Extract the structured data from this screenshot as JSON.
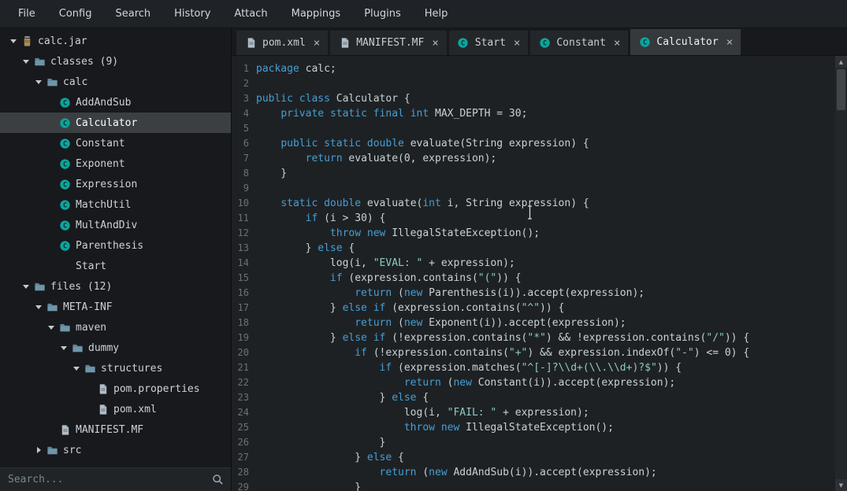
{
  "menu": {
    "items": [
      "File",
      "Config",
      "Search",
      "History",
      "Attach",
      "Mappings",
      "Plugins",
      "Help"
    ]
  },
  "sidebar": {
    "tree": [
      {
        "label": "calc.jar",
        "level": 0,
        "icon": "jar",
        "arrow": "expanded"
      },
      {
        "label": "classes (9)",
        "level": 1,
        "icon": "folder",
        "arrow": "expanded"
      },
      {
        "label": "calc",
        "level": 2,
        "icon": "folder",
        "arrow": "expanded"
      },
      {
        "label": "AddAndSub",
        "level": 3,
        "icon": "class"
      },
      {
        "label": "Calculator",
        "level": 3,
        "icon": "class",
        "selected": true
      },
      {
        "label": "Constant",
        "level": 3,
        "icon": "class"
      },
      {
        "label": "Exponent",
        "level": 3,
        "icon": "class"
      },
      {
        "label": "Expression",
        "level": 3,
        "icon": "class"
      },
      {
        "label": "MatchUtil",
        "level": 3,
        "icon": "class"
      },
      {
        "label": "MultAndDiv",
        "level": 3,
        "icon": "class"
      },
      {
        "label": "Parenthesis",
        "level": 3,
        "icon": "class"
      },
      {
        "label": "Start",
        "level": 3,
        "icon": "none"
      },
      {
        "label": "files (12)",
        "level": 1,
        "icon": "folder",
        "arrow": "expanded"
      },
      {
        "label": "META-INF",
        "level": 2,
        "icon": "folder",
        "arrow": "expanded"
      },
      {
        "label": "maven",
        "level": 3,
        "icon": "folder",
        "arrow": "expanded"
      },
      {
        "label": "dummy",
        "level": 4,
        "icon": "folder",
        "arrow": "expanded"
      },
      {
        "label": "structures",
        "level": 5,
        "icon": "folder",
        "arrow": "expanded"
      },
      {
        "label": "pom.properties",
        "level": 6,
        "icon": "file"
      },
      {
        "label": "pom.xml",
        "level": 6,
        "icon": "file"
      },
      {
        "label": "MANIFEST.MF",
        "level": 3,
        "icon": "file"
      },
      {
        "label": "src",
        "level": 2,
        "icon": "folder",
        "arrow": "collapsed"
      }
    ],
    "search": {
      "placeholder": "Search..."
    }
  },
  "tabs": {
    "close_glyph": "×",
    "items": [
      {
        "label": "pom.xml",
        "icon": "file",
        "active": false
      },
      {
        "label": "MANIFEST.MF",
        "icon": "file",
        "active": false
      },
      {
        "label": "Start",
        "icon": "class",
        "active": false
      },
      {
        "label": "Constant",
        "icon": "class",
        "active": false
      },
      {
        "label": "Calculator",
        "icon": "class",
        "active": true
      }
    ]
  },
  "editor": {
    "lines": [
      {
        "n": 1,
        "segs": [
          [
            "kw",
            "package"
          ],
          [
            "pl",
            " calc;"
          ]
        ]
      },
      {
        "n": 2,
        "segs": []
      },
      {
        "n": 3,
        "segs": [
          [
            "kw",
            "public"
          ],
          [
            "pl",
            " "
          ],
          [
            "kw",
            "class"
          ],
          [
            "pl",
            " Calculator {"
          ]
        ]
      },
      {
        "n": 4,
        "segs": [
          [
            "pl",
            "    "
          ],
          [
            "kw",
            "private"
          ],
          [
            "pl",
            " "
          ],
          [
            "kw",
            "static"
          ],
          [
            "pl",
            " "
          ],
          [
            "kw",
            "final"
          ],
          [
            "pl",
            " "
          ],
          [
            "kw",
            "int"
          ],
          [
            "pl",
            " MAX_DEPTH = 30;"
          ]
        ]
      },
      {
        "n": 5,
        "segs": []
      },
      {
        "n": 6,
        "segs": [
          [
            "pl",
            "    "
          ],
          [
            "kw",
            "public"
          ],
          [
            "pl",
            " "
          ],
          [
            "kw",
            "static"
          ],
          [
            "pl",
            " "
          ],
          [
            "kw",
            "double"
          ],
          [
            "pl",
            " evaluate(String expression) {"
          ]
        ]
      },
      {
        "n": 7,
        "segs": [
          [
            "pl",
            "        "
          ],
          [
            "kw",
            "return"
          ],
          [
            "pl",
            " evaluate(0, expression);"
          ]
        ]
      },
      {
        "n": 8,
        "segs": [
          [
            "pl",
            "    }"
          ]
        ]
      },
      {
        "n": 9,
        "segs": []
      },
      {
        "n": 10,
        "segs": [
          [
            "pl",
            "    "
          ],
          [
            "kw",
            "static"
          ],
          [
            "pl",
            " "
          ],
          [
            "kw",
            "double"
          ],
          [
            "pl",
            " evaluate("
          ],
          [
            "kw",
            "int"
          ],
          [
            "pl",
            " i, String expression) {"
          ]
        ]
      },
      {
        "n": 11,
        "segs": [
          [
            "pl",
            "        "
          ],
          [
            "kw",
            "if"
          ],
          [
            "pl",
            " (i > 30) {"
          ]
        ]
      },
      {
        "n": 12,
        "segs": [
          [
            "pl",
            "            "
          ],
          [
            "kw",
            "throw"
          ],
          [
            "pl",
            " "
          ],
          [
            "kw",
            "new"
          ],
          [
            "pl",
            " IllegalStateException();"
          ]
        ]
      },
      {
        "n": 13,
        "segs": [
          [
            "pl",
            "        } "
          ],
          [
            "kw",
            "else"
          ],
          [
            "pl",
            " {"
          ]
        ]
      },
      {
        "n": 14,
        "segs": [
          [
            "pl",
            "            log(i, "
          ],
          [
            "str",
            "\"EVAL: \""
          ],
          [
            "pl",
            " + expression);"
          ]
        ]
      },
      {
        "n": 15,
        "segs": [
          [
            "pl",
            "            "
          ],
          [
            "kw",
            "if"
          ],
          [
            "pl",
            " (expression.contains("
          ],
          [
            "str",
            "\"(\""
          ],
          [
            "pl",
            ")) {"
          ]
        ]
      },
      {
        "n": 16,
        "segs": [
          [
            "pl",
            "                "
          ],
          [
            "kw",
            "return"
          ],
          [
            "pl",
            " ("
          ],
          [
            "kw",
            "new"
          ],
          [
            "pl",
            " Parenthesis(i)).accept(expression);"
          ]
        ]
      },
      {
        "n": 17,
        "segs": [
          [
            "pl",
            "            } "
          ],
          [
            "kw",
            "else"
          ],
          [
            "pl",
            " "
          ],
          [
            "kw",
            "if"
          ],
          [
            "pl",
            " (expression.contains("
          ],
          [
            "str",
            "\"^\""
          ],
          [
            "pl",
            ")) {"
          ]
        ]
      },
      {
        "n": 18,
        "segs": [
          [
            "pl",
            "                "
          ],
          [
            "kw",
            "return"
          ],
          [
            "pl",
            " ("
          ],
          [
            "kw",
            "new"
          ],
          [
            "pl",
            " Exponent(i)).accept(expression);"
          ]
        ]
      },
      {
        "n": 19,
        "segs": [
          [
            "pl",
            "            } "
          ],
          [
            "kw",
            "else"
          ],
          [
            "pl",
            " "
          ],
          [
            "kw",
            "if"
          ],
          [
            "pl",
            " (!expression.contains("
          ],
          [
            "str",
            "\"*\""
          ],
          [
            "pl",
            ") && !expression.contains("
          ],
          [
            "str",
            "\"/\""
          ],
          [
            "pl",
            ")) {"
          ]
        ]
      },
      {
        "n": 20,
        "segs": [
          [
            "pl",
            "                "
          ],
          [
            "kw",
            "if"
          ],
          [
            "pl",
            " (!expression.contains("
          ],
          [
            "str",
            "\"+\""
          ],
          [
            "pl",
            ") && expression.indexOf("
          ],
          [
            "str",
            "\"-\""
          ],
          [
            "pl",
            ") <= 0) {"
          ]
        ]
      },
      {
        "n": 21,
        "segs": [
          [
            "pl",
            "                    "
          ],
          [
            "kw",
            "if"
          ],
          [
            "pl",
            " (expression.matches("
          ],
          [
            "str",
            "\"^[-]?\\\\d+(\\\\.\\\\d+)?$\""
          ],
          [
            "pl",
            ")) {"
          ]
        ]
      },
      {
        "n": 22,
        "segs": [
          [
            "pl",
            "                        "
          ],
          [
            "kw",
            "return"
          ],
          [
            "pl",
            " ("
          ],
          [
            "kw",
            "new"
          ],
          [
            "pl",
            " Constant(i)).accept(expression);"
          ]
        ]
      },
      {
        "n": 23,
        "segs": [
          [
            "pl",
            "                    } "
          ],
          [
            "kw",
            "else"
          ],
          [
            "pl",
            " {"
          ]
        ]
      },
      {
        "n": 24,
        "segs": [
          [
            "pl",
            "                        log(i, "
          ],
          [
            "str",
            "\"FAIL: \""
          ],
          [
            "pl",
            " + expression);"
          ]
        ]
      },
      {
        "n": 25,
        "segs": [
          [
            "pl",
            "                        "
          ],
          [
            "kw",
            "throw"
          ],
          [
            "pl",
            " "
          ],
          [
            "kw",
            "new"
          ],
          [
            "pl",
            " IllegalStateException();"
          ]
        ]
      },
      {
        "n": 26,
        "segs": [
          [
            "pl",
            "                    }"
          ]
        ]
      },
      {
        "n": 27,
        "segs": [
          [
            "pl",
            "                } "
          ],
          [
            "kw",
            "else"
          ],
          [
            "pl",
            " {"
          ]
        ]
      },
      {
        "n": 28,
        "segs": [
          [
            "pl",
            "                    "
          ],
          [
            "kw",
            "return"
          ],
          [
            "pl",
            " ("
          ],
          [
            "kw",
            "new"
          ],
          [
            "pl",
            " AddAndSub(i)).accept(expression);"
          ]
        ]
      },
      {
        "n": 29,
        "segs": [
          [
            "pl",
            "                }"
          ]
        ]
      }
    ]
  },
  "scrollbar": {
    "up_glyph": "▲",
    "down_glyph": "▼"
  },
  "colors": {
    "keyword": "#459fd6",
    "string": "#8bcbc7",
    "plain_code": "#c9d2d8",
    "editor_bg": "#1e2123",
    "sidebar_bg": "#17191c",
    "selection_bg": "#3b3f42",
    "class_icon": "#0da49e",
    "folder_icon": "#5d8396"
  }
}
